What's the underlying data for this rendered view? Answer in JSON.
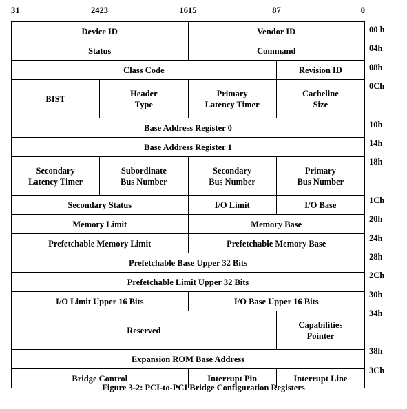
{
  "figure": {
    "caption": "Figure 3-2:  PCI-to-PCI Bridge Configuration Registers",
    "bit_ruler": [
      {
        "label": "31",
        "bit": 31,
        "align": "left",
        "pct": 0
      },
      {
        "label": "24",
        "bit": 24,
        "align": "right",
        "pct": 25
      },
      {
        "label": "23",
        "bit": 23,
        "align": "left",
        "pct": 25
      },
      {
        "label": "16",
        "bit": 16,
        "align": "right",
        "pct": 50
      },
      {
        "label": "15",
        "bit": 15,
        "align": "left",
        "pct": 50
      },
      {
        "label": "8",
        "bit": 8,
        "align": "right",
        "pct": 75
      },
      {
        "label": "7",
        "bit": 7,
        "align": "left",
        "pct": 75
      },
      {
        "label": "0",
        "bit": 0,
        "align": "right",
        "pct": 100
      }
    ],
    "rows": [
      {
        "offset": "00 h",
        "height": "single",
        "fields": [
          {
            "name": "Device ID",
            "span": 2
          },
          {
            "name": "Vendor ID",
            "span": 2
          }
        ]
      },
      {
        "offset": "04h",
        "height": "single",
        "fields": [
          {
            "name": "Status",
            "span": 2
          },
          {
            "name": "Command",
            "span": 2
          }
        ]
      },
      {
        "offset": "08h",
        "height": "single",
        "fields": [
          {
            "name": "Class Code",
            "span": 3
          },
          {
            "name": "Revision ID",
            "span": 1
          }
        ]
      },
      {
        "offset": "0Ch",
        "height": "double",
        "fields": [
          {
            "name": "BIST",
            "span": 1
          },
          {
            "name": "Header\nType",
            "span": 1
          },
          {
            "name": "Primary\nLatency Timer",
            "span": 1
          },
          {
            "name": "Cacheline\nSize",
            "span": 1
          }
        ]
      },
      {
        "offset": "10h",
        "height": "single",
        "fields": [
          {
            "name": "Base Address Register 0",
            "span": 4
          }
        ]
      },
      {
        "offset": "14h",
        "height": "single",
        "fields": [
          {
            "name": "Base Address Register 1",
            "span": 4
          }
        ]
      },
      {
        "offset": "18h",
        "height": "double",
        "fields": [
          {
            "name": "Secondary\nLatency Timer",
            "span": 1
          },
          {
            "name": "Subordinate\nBus Number",
            "span": 1
          },
          {
            "name": "Secondary\nBus Number",
            "span": 1
          },
          {
            "name": "Primary\nBus Number",
            "span": 1
          }
        ]
      },
      {
        "offset": "1Ch",
        "height": "single",
        "fields": [
          {
            "name": "Secondary Status",
            "span": 2
          },
          {
            "name": "I/O Limit",
            "span": 1
          },
          {
            "name": "I/O Base",
            "span": 1
          }
        ]
      },
      {
        "offset": "20h",
        "height": "single",
        "fields": [
          {
            "name": "Memory Limit",
            "span": 2
          },
          {
            "name": "Memory Base",
            "span": 2
          }
        ]
      },
      {
        "offset": "24h",
        "height": "single",
        "fields": [
          {
            "name": "Prefetchable Memory Limit",
            "span": 2
          },
          {
            "name": "Prefetchable Memory Base",
            "span": 2
          }
        ]
      },
      {
        "offset": "28h",
        "height": "single",
        "fields": [
          {
            "name": "Prefetchable Base Upper 32 Bits",
            "span": 4
          }
        ]
      },
      {
        "offset": "2Ch",
        "height": "single",
        "fields": [
          {
            "name": "Prefetchable Limit Upper 32 Bits",
            "span": 4
          }
        ]
      },
      {
        "offset": "30h",
        "height": "single",
        "fields": [
          {
            "name": "I/O Limit Upper 16 Bits",
            "span": 2
          },
          {
            "name": "I/O Base Upper 16 Bits",
            "span": 2
          }
        ]
      },
      {
        "offset": "34h",
        "height": "double",
        "fields": [
          {
            "name": "Reserved",
            "span": 3
          },
          {
            "name": "Capabilities\nPointer",
            "span": 1
          }
        ]
      },
      {
        "offset": "38h",
        "height": "single",
        "fields": [
          {
            "name": "Expansion ROM Base Address",
            "span": 4
          }
        ]
      },
      {
        "offset": "3Ch",
        "height": "single",
        "fields": [
          {
            "name": "Bridge Control",
            "span": 2
          },
          {
            "name": "Interrupt Pin",
            "span": 1
          },
          {
            "name": "Interrupt Line",
            "span": 1
          }
        ]
      }
    ]
  },
  "colors": {
    "border": "#000000",
    "text": "#000000",
    "background": "#ffffff"
  }
}
